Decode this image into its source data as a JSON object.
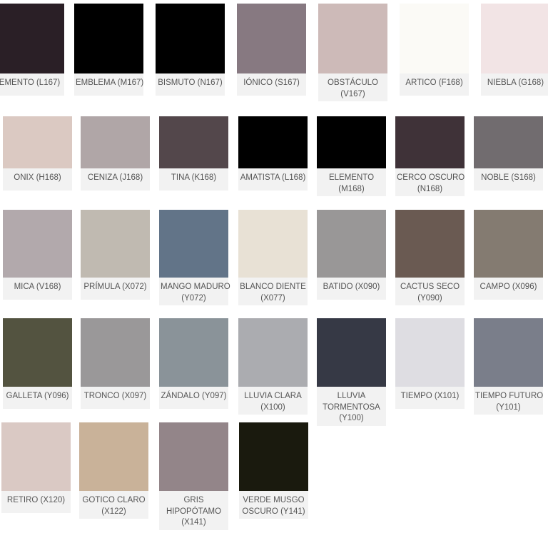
{
  "rows": [
    [
      {
        "lines": [
          "EMENTO (L167)"
        ],
        "color": "#2a1f26"
      },
      {
        "lines": [
          "EMBLEMA (M167)"
        ],
        "color": "#000000"
      },
      {
        "lines": [
          "BISMUTO (N167)"
        ],
        "color": "#000000"
      },
      {
        "lines": [
          "IÓNICO (S167)"
        ],
        "color": "#877981"
      },
      {
        "lines": [
          "OBSTÁCULO",
          "(V167)"
        ],
        "color": "#cdbab8"
      },
      {
        "lines": [
          "ARTICO (F168)"
        ],
        "color": "#fbfaf6"
      },
      {
        "lines": [
          "NIEBLA (G168)"
        ],
        "color": "#f2e4e5"
      }
    ],
    [
      {
        "lines": [
          "ONIX (H168)"
        ],
        "color": "#dbc9c2"
      },
      {
        "lines": [
          "CENIZA (J168)"
        ],
        "color": "#b0a6a7"
      },
      {
        "lines": [
          "TINA (K168)"
        ],
        "color": "#53474b"
      },
      {
        "lines": [
          "AMATISTA (L168)"
        ],
        "color": "#000000"
      },
      {
        "lines": [
          "ELEMENTO",
          "(M168)"
        ],
        "color": "#000000"
      },
      {
        "lines": [
          "CERCO OSCURO",
          "(N168)"
        ],
        "color": "#3f3238"
      },
      {
        "lines": [
          "NOBLE (S168)"
        ],
        "color": "#716c6f"
      }
    ],
    [
      {
        "lines": [
          "MICA (V168)"
        ],
        "color": "#b2a9ac"
      },
      {
        "lines": [
          "PRÍMULA (X072)"
        ],
        "color": "#c0bab1"
      },
      {
        "lines": [
          "MANGO MADURO",
          "(Y072)"
        ],
        "color": "#627488"
      },
      {
        "lines": [
          "BLANCO DIENTE",
          "(X077)"
        ],
        "color": "#e8e1d5"
      },
      {
        "lines": [
          "BATIDO (X090)"
        ],
        "color": "#999797"
      },
      {
        "lines": [
          "CACTUS SECO",
          "(Y090)"
        ],
        "color": "#6a5a52"
      },
      {
        "lines": [
          "CAMPO (X096)"
        ],
        "color": "#847b71"
      }
    ],
    [
      {
        "lines": [
          "GALLETA (Y096)"
        ],
        "color": "#535340"
      },
      {
        "lines": [
          "TRONCO (X097)"
        ],
        "color": "#9a9899"
      },
      {
        "lines": [
          "ZÁNDALO (Y097)"
        ],
        "color": "#8a9399"
      },
      {
        "lines": [
          "LLUVIA CLARA",
          "(X100)"
        ],
        "color": "#abacb0"
      },
      {
        "lines": [
          "LLUVIA",
          "TORMENTOSA",
          "(Y100)"
        ],
        "color": "#363945"
      },
      {
        "lines": [
          "TIEMPO (X101)"
        ],
        "color": "#dedde2"
      },
      {
        "lines": [
          "TIEMPO FUTURO",
          "(Y101)"
        ],
        "color": "#7a7e8a"
      }
    ],
    [
      {
        "lines": [
          "RETIRO (X120)"
        ],
        "color": "#dac9c4"
      },
      {
        "lines": [
          "GOTICO CLARO",
          "(X122)"
        ],
        "color": "#c9b299"
      },
      {
        "lines": [
          "GRIS",
          "HIPOPÓTAMO",
          "(X141)"
        ],
        "color": "#938589"
      },
      {
        "lines": [
          "VERDE MUSGO",
          "OSCURO (Y141)"
        ],
        "color": "#1a1a0e"
      }
    ]
  ]
}
